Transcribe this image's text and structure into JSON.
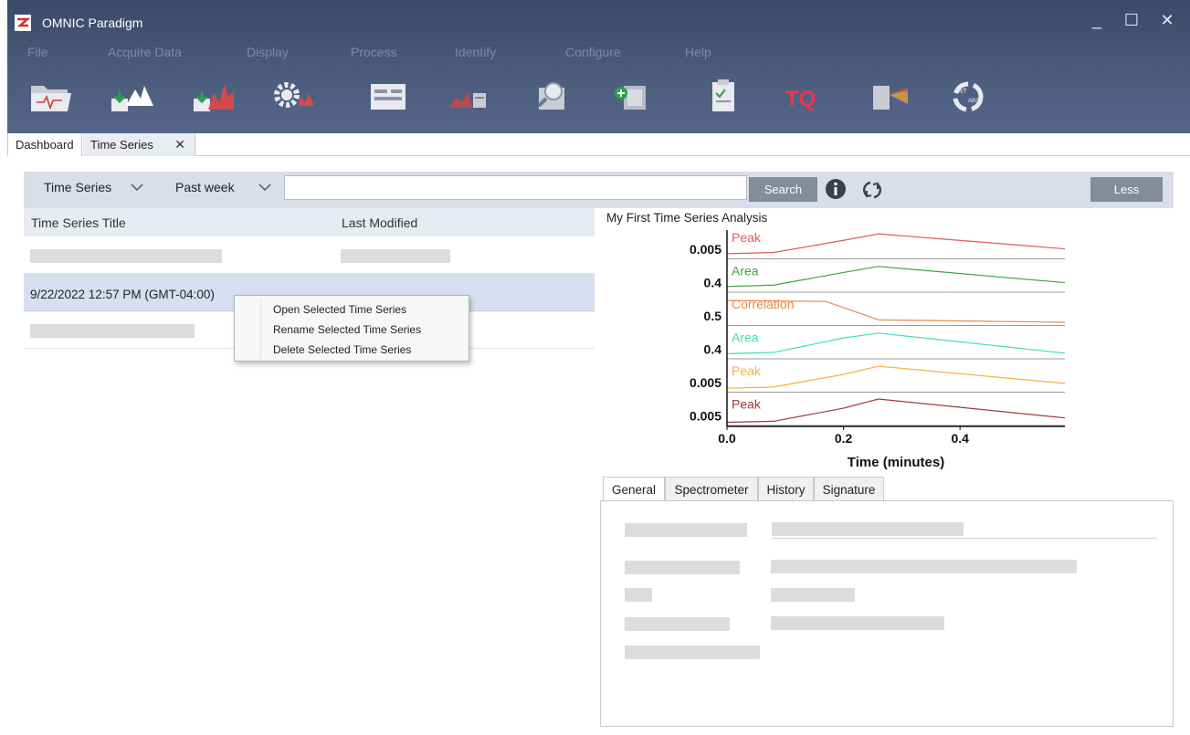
{
  "app": {
    "title": "OMNIC Paradigm",
    "window_controls": [
      "_",
      "☐",
      "✕"
    ]
  },
  "menu": [
    "File",
    "Acquire Data",
    "Display",
    "Process",
    "Identify",
    "Configure",
    "Help"
  ],
  "toolbar": {
    "buttons": [
      "open-folder-icon",
      "acquire-sample-icon",
      "acquire-background-icon",
      "settings-icon",
      "display-view-icon",
      "process-spectrum-icon",
      "identify-search-icon",
      "add-library-icon",
      "report-clipboard-icon",
      "to-icon",
      "prism-icon",
      "transmittance-absorbance-icon"
    ],
    "to_label": "TQ"
  },
  "doc_tabs": {
    "dashboard": "Dashboard",
    "time_series": "Time Series",
    "close": "✕"
  },
  "search": {
    "type_dropdown": "Time Series",
    "date_dropdown": "Past week",
    "value": "",
    "button": "Search",
    "less_button": "Less"
  },
  "list": {
    "columns": [
      "Time Series Title",
      "Last Modified"
    ],
    "selected_row_text": "9/22/2022 12:57 PM (GMT-04:00)"
  },
  "context_menu": [
    "Open Selected Time Series",
    "Rename Selected Time Series",
    "Delete Selected Time Series"
  ],
  "chart_data": {
    "type": "line",
    "title": "My First Time Series Analysis",
    "xlabel": "Time (minutes)",
    "x_ticks": [
      "0.0",
      "0.2",
      "0.4"
    ],
    "xlim": [
      0,
      0.58
    ],
    "series": [
      {
        "name": "Peak",
        "tick": "0.005",
        "color": "#e05a5a",
        "points": [
          [
            0,
            0.1
          ],
          [
            0.08,
            0.15
          ],
          [
            0.2,
            0.65
          ],
          [
            0.26,
            0.92
          ],
          [
            0.58,
            0.3
          ]
        ]
      },
      {
        "name": "Area",
        "tick": "0.4",
        "color": "#3da43d",
        "points": [
          [
            0,
            0.12
          ],
          [
            0.08,
            0.18
          ],
          [
            0.2,
            0.7
          ],
          [
            0.26,
            0.95
          ],
          [
            0.58,
            0.28
          ]
        ]
      },
      {
        "name": "Correlation",
        "tick": "0.5",
        "color": "#e8894a",
        "points": [
          [
            0,
            0.92
          ],
          [
            0.08,
            0.9
          ],
          [
            0.17,
            0.88
          ],
          [
            0.26,
            0.12
          ],
          [
            0.58,
            0.02
          ]
        ]
      },
      {
        "name": "Area",
        "tick": "0.4",
        "color": "#3ee0b0",
        "points": [
          [
            0,
            0.1
          ],
          [
            0.08,
            0.15
          ],
          [
            0.2,
            0.75
          ],
          [
            0.26,
            0.95
          ],
          [
            0.58,
            0.12
          ]
        ]
      },
      {
        "name": "Peak",
        "tick": "0.005",
        "color": "#f0b040",
        "points": [
          [
            0,
            0.05
          ],
          [
            0.08,
            0.1
          ],
          [
            0.2,
            0.62
          ],
          [
            0.26,
            0.96
          ],
          [
            0.58,
            0.25
          ]
        ]
      },
      {
        "name": "Peak",
        "tick": "0.005",
        "color": "#a03a3a",
        "points": [
          [
            0,
            0.02
          ],
          [
            0.08,
            0.06
          ],
          [
            0.2,
            0.6
          ],
          [
            0.26,
            0.98
          ],
          [
            0.58,
            0.2
          ]
        ]
      }
    ],
    "grid": false,
    "legend": "labels at left of each strip"
  },
  "detail_tabs": [
    "General",
    "Spectrometer",
    "History",
    "Signature"
  ],
  "colors": {
    "chrome": "#4c5d7d",
    "selection": "#d6dff0",
    "button": "#848b99"
  }
}
